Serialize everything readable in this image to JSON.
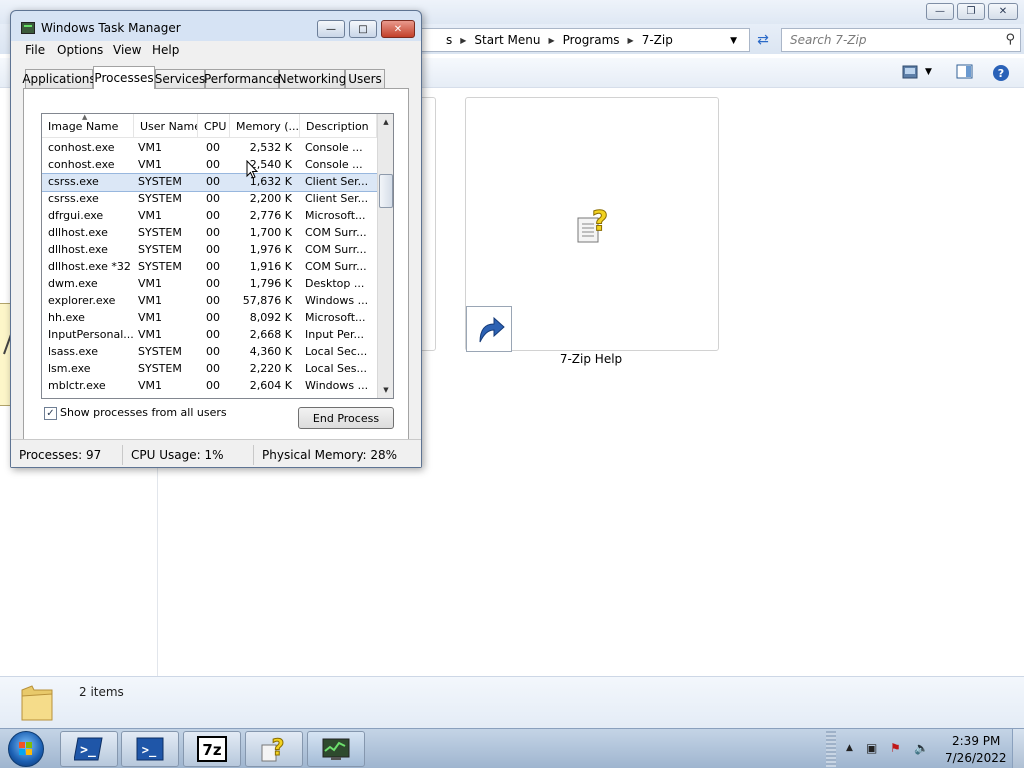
{
  "explorer": {
    "breadcrumb": [
      "s",
      "Start Menu",
      "Programs",
      "7-Zip"
    ],
    "search_placeholder": "Search 7-Zip",
    "items": [
      {
        "label": "7-Zip Help"
      }
    ],
    "details": "2 items"
  },
  "taskmgr": {
    "title": "Windows Task Manager",
    "menu": [
      "File",
      "Options",
      "View",
      "Help"
    ],
    "tabs": [
      "Applications",
      "Processes",
      "Services",
      "Performance",
      "Networking",
      "Users"
    ],
    "active_tab": "Processes",
    "columns": [
      "Image Name",
      "User Name",
      "CPU",
      "Memory (...",
      "Description"
    ],
    "processes": [
      {
        "name": "conhost.exe",
        "user": "VM1",
        "cpu": "00",
        "mem": "2,532 K",
        "desc": "Console ..."
      },
      {
        "name": "conhost.exe",
        "user": "VM1",
        "cpu": "00",
        "mem": "2,540 K",
        "desc": "Console ..."
      },
      {
        "name": "csrss.exe",
        "user": "SYSTEM",
        "cpu": "00",
        "mem": "1,632 K",
        "desc": "Client Ser..."
      },
      {
        "name": "csrss.exe",
        "user": "SYSTEM",
        "cpu": "00",
        "mem": "2,200 K",
        "desc": "Client Ser..."
      },
      {
        "name": "dfrgui.exe",
        "user": "VM1",
        "cpu": "00",
        "mem": "2,776 K",
        "desc": "Microsoft..."
      },
      {
        "name": "dllhost.exe",
        "user": "SYSTEM",
        "cpu": "00",
        "mem": "1,700 K",
        "desc": "COM Surr..."
      },
      {
        "name": "dllhost.exe",
        "user": "SYSTEM",
        "cpu": "00",
        "mem": "1,976 K",
        "desc": "COM Surr..."
      },
      {
        "name": "dllhost.exe *32",
        "user": "SYSTEM",
        "cpu": "00",
        "mem": "1,916 K",
        "desc": "COM Surr..."
      },
      {
        "name": "dwm.exe",
        "user": "VM1",
        "cpu": "00",
        "mem": "1,796 K",
        "desc": "Desktop ..."
      },
      {
        "name": "explorer.exe",
        "user": "VM1",
        "cpu": "00",
        "mem": "57,876 K",
        "desc": "Windows ..."
      },
      {
        "name": "hh.exe",
        "user": "VM1",
        "cpu": "00",
        "mem": "8,092 K",
        "desc": "Microsoft..."
      },
      {
        "name": "InputPersonal...",
        "user": "VM1",
        "cpu": "00",
        "mem": "2,668 K",
        "desc": "Input Per..."
      },
      {
        "name": "lsass.exe",
        "user": "SYSTEM",
        "cpu": "00",
        "mem": "4,360 K",
        "desc": "Local Sec..."
      },
      {
        "name": "lsm.exe",
        "user": "SYSTEM",
        "cpu": "00",
        "mem": "2,220 K",
        "desc": "Local Ses..."
      },
      {
        "name": "mblctr.exe",
        "user": "VM1",
        "cpu": "00",
        "mem": "2,604 K",
        "desc": "Windows ..."
      }
    ],
    "selected_index": 2,
    "show_all_label": "Show processes from all users",
    "show_all_checked": true,
    "end_process_label": "End Process",
    "status": {
      "processes": "Processes: 97",
      "cpu": "CPU Usage: 1%",
      "memory": "Physical Memory: 28%"
    }
  },
  "taskbar": {
    "buttons": [
      "powershell-icon",
      "powershell-icon",
      "7zip-icon",
      "help-icon",
      "taskmgr-icon"
    ],
    "clock_time": "2:39 PM",
    "clock_date": "7/26/2022"
  }
}
